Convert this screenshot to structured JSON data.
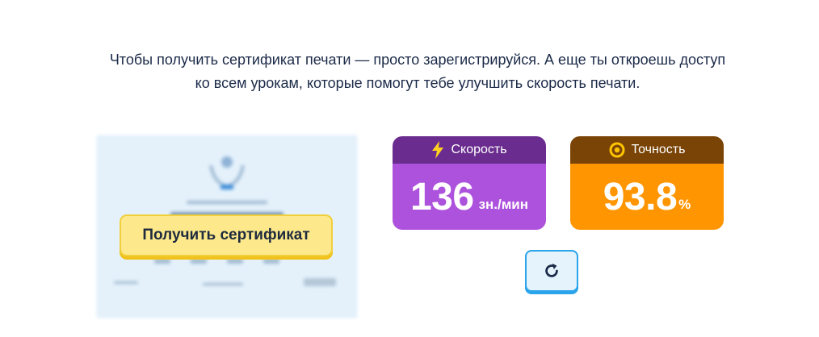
{
  "intro": {
    "text": "Чтобы получить сертификат печати — просто зарегистрируйся. А еще ты откроешь доступ ко всем урокам, которые помогут тебе улучшить скорость печати."
  },
  "certificate": {
    "button_label": "Получить сертификат"
  },
  "stats": {
    "speed": {
      "label": "Скорость",
      "value": "136",
      "unit": "зн./мин",
      "icon": "lightning-icon"
    },
    "accuracy": {
      "label": "Точность",
      "value": "93.8",
      "unit": "%",
      "icon": "target-icon"
    }
  },
  "actions": {
    "restart_icon": "restart-icon"
  },
  "colors": {
    "speed_header": "#6a2d8f",
    "speed_body": "#ad52dc",
    "accuracy_header": "#7a4407",
    "accuracy_body": "#ff9500",
    "cert_button": "#fde98c",
    "restart_border": "#2aa4ea"
  }
}
